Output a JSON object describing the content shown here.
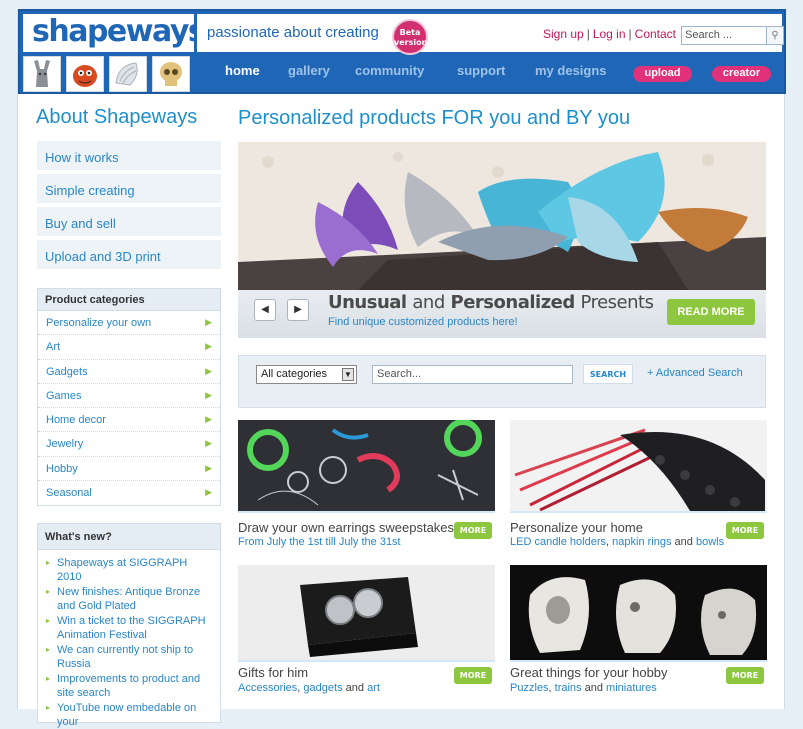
{
  "header": {
    "logo": "shapeways",
    "tagline": "passionate about creating",
    "beta_line1": "Beta",
    "beta_line2": "version",
    "links": {
      "signup": "Sign up",
      "login": "Log in",
      "contact": "Contact"
    },
    "search_placeholder": "Search ...",
    "nav": [
      "home",
      "gallery",
      "community",
      "support",
      "my designs"
    ],
    "upload": "upload",
    "creator": "creator"
  },
  "sidebar": {
    "about_title": "About Shapeways",
    "about_links": [
      "How it works",
      "Simple creating",
      "Buy and sell",
      "Upload and 3D print"
    ],
    "categories_title": "Product categories",
    "categories": [
      "Personalize your own",
      "Art",
      "Gadgets",
      "Games",
      "Home decor",
      "Jewelry",
      "Hobby",
      "Seasonal"
    ],
    "news_title": "What's new?",
    "news": [
      "Shapeways at SIGGRAPH 2010",
      "New finishes: Antique Bronze and Gold Plated",
      "Win a ticket to the SIGGRAPH Animation Festival",
      "We can currently not ship to Russia",
      "Improvements to product and site search",
      "YouTube now embedable on your"
    ]
  },
  "main": {
    "title": "Personalized products FOR you and BY you",
    "hero": {
      "heading_bold1": "Unusual",
      "heading_light": "and",
      "heading_bold2": "Personalized",
      "heading_end": "Presents",
      "subtitle": "Find unique customized products here!",
      "read_more": "READ MORE"
    },
    "search": {
      "category": "All categories",
      "placeholder": "Search...",
      "button": "SEARCH",
      "advanced": "+ Advanced Search"
    },
    "more_label": "MORE",
    "cards": {
      "earrings": {
        "title": "Draw your own earrings sweepstakes",
        "sub": "From July the 1st till July the 31st"
      },
      "home": {
        "title": "Personalize your home",
        "link1": "LED candle holders",
        "sep": ",",
        "link2": "napkin rings",
        "and": "and",
        "link3": "bowls"
      },
      "gifts": {
        "title": "Gifts for him",
        "link1": "Accessories",
        "sep": ",",
        "link2": "gadgets",
        "and": "and",
        "link3": "art"
      },
      "hobby": {
        "title": "Great things for your hobby",
        "link1": "Puzzles",
        "sep": ",",
        "link2": "trains",
        "and": "and",
        "link3": "miniatures"
      }
    }
  }
}
